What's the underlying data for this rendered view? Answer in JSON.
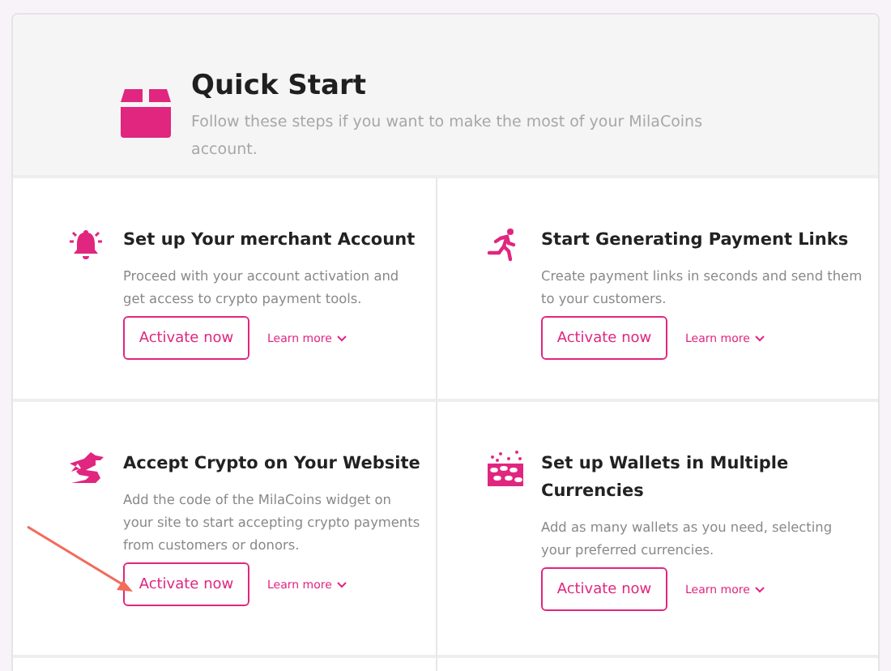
{
  "header": {
    "title": "Quick Start",
    "subtitle": "Follow these steps if you want to make the most of your MilaCoins account."
  },
  "steps": [
    {
      "title": "Set up Your merchant Account",
      "description": "Proceed with your account activation and get access to crypto payment tools.",
      "action": "Activate now",
      "link": "Learn more"
    },
    {
      "title": "Start Generating Payment Links",
      "description": "Create payment links in seconds and send them to your customers.",
      "action": "Activate now",
      "link": "Learn more"
    },
    {
      "title": "Accept Crypto on Your Website",
      "description": "Add the code of the MilaCoins widget on your site to start accepting crypto payments from customers or donors.",
      "action": "Activate now",
      "link": "Learn more"
    },
    {
      "title": "Set up Wallets in Multiple Currencies",
      "description": "Add as many wallets as you need, selecting your preferred currencies.",
      "action": "Activate now",
      "link": "Learn more"
    }
  ]
}
